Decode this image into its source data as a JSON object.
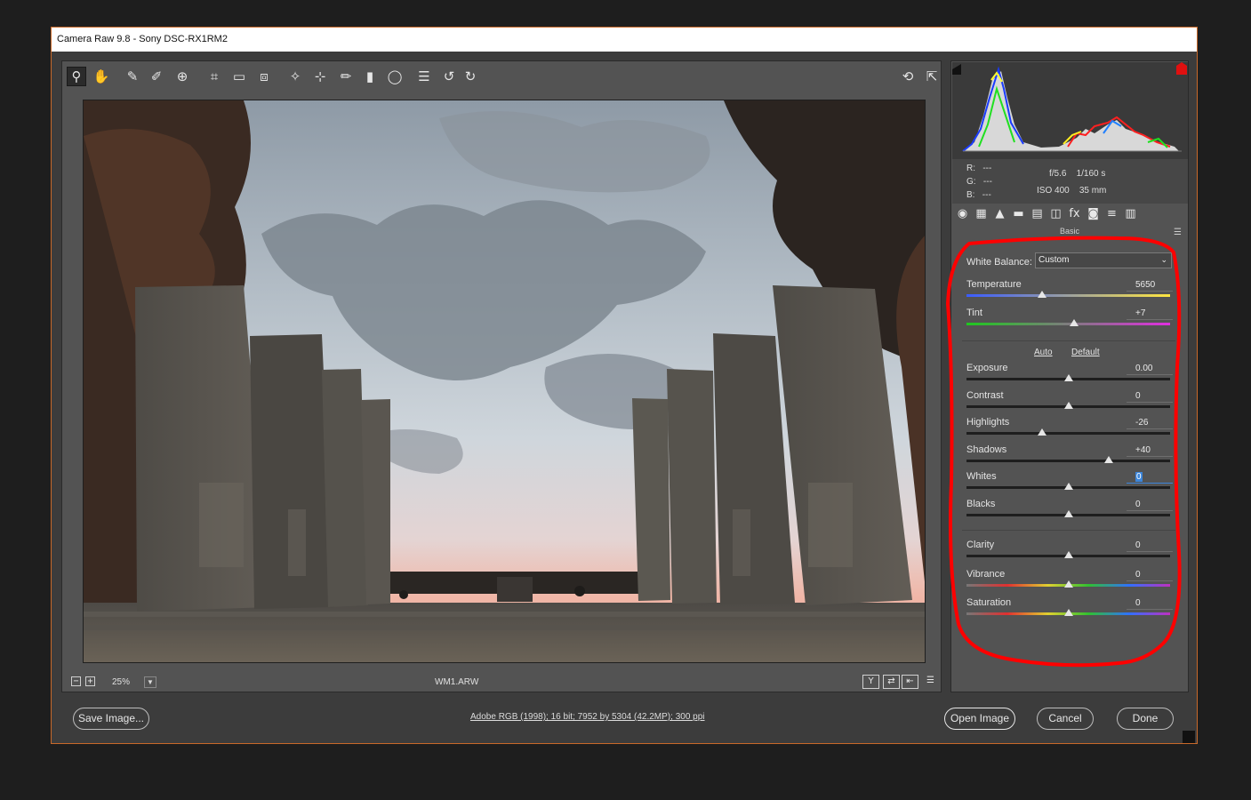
{
  "window": {
    "title": "Camera Raw 9.8  -  Sony DSC-RX1RM2"
  },
  "toolbar": {
    "tools": [
      {
        "name": "zoom-tool",
        "glyph": "⚲",
        "active": true
      },
      {
        "name": "hand-tool",
        "glyph": "✋"
      },
      {
        "name": "white-balance-tool",
        "glyph": "✎"
      },
      {
        "name": "color-sampler-tool",
        "glyph": "✐"
      },
      {
        "name": "targeted-adjustment-tool",
        "glyph": "⊕"
      },
      {
        "name": "crop-tool",
        "glyph": "⌗"
      },
      {
        "name": "straighten-tool",
        "glyph": "▭"
      },
      {
        "name": "transform-tool",
        "glyph": "⧈"
      },
      {
        "name": "spot-removal-tool",
        "glyph": "✧"
      },
      {
        "name": "red-eye-tool",
        "glyph": "⊹"
      },
      {
        "name": "adjustment-brush-tool",
        "glyph": "✏"
      },
      {
        "name": "graduated-filter-tool",
        "glyph": "▮"
      },
      {
        "name": "radial-filter-tool",
        "glyph": "◯"
      },
      {
        "name": "preferences-tool",
        "glyph": "☰"
      },
      {
        "name": "rotate-left-tool",
        "glyph": "↺"
      },
      {
        "name": "rotate-right-tool",
        "glyph": "↻"
      }
    ],
    "right_tools": [
      {
        "name": "toggle-mark-icon",
        "glyph": "⟲"
      },
      {
        "name": "fullscreen-icon",
        "glyph": "⇱"
      }
    ]
  },
  "preview": {
    "filename": "WM1.ARW",
    "zoom": "25%"
  },
  "bottom_bar": {
    "view_buttons": [
      "Y",
      "⇄",
      "⇤",
      "☰"
    ]
  },
  "histogram_info": {
    "r_label": "R:",
    "g_label": "G:",
    "b_label": "B:",
    "r_value": "---",
    "g_value": "---",
    "b_value": "---",
    "aperture": "f/5.6",
    "shutter": "1/160 s",
    "iso": "ISO 400",
    "focal": "35 mm"
  },
  "panel_tabs": [
    "◉",
    "▦",
    "▲",
    "▬",
    "▤",
    "◫",
    "fx",
    "◙",
    "≡",
    "▥"
  ],
  "panel": {
    "title": "Basic",
    "white_balance_label": "White Balance:",
    "white_balance_value": "Custom",
    "auto_label": "Auto",
    "default_label": "Default"
  },
  "sliders": [
    {
      "key": "temperature",
      "label": "Temperature",
      "value": "5650",
      "pos": 0.37
    },
    {
      "key": "tint",
      "label": "Tint",
      "value": "+7",
      "pos": 0.53
    },
    {
      "key": "exposure",
      "label": "Exposure",
      "value": "0.00",
      "pos": 0.5
    },
    {
      "key": "contrast",
      "label": "Contrast",
      "value": "0",
      "pos": 0.5
    },
    {
      "key": "highlights",
      "label": "Highlights",
      "value": "-26",
      "pos": 0.37
    },
    {
      "key": "shadows",
      "label": "Shadows",
      "value": "+40",
      "pos": 0.7
    },
    {
      "key": "whites",
      "label": "Whites",
      "value": "0",
      "pos": 0.5
    },
    {
      "key": "blacks",
      "label": "Blacks",
      "value": "0",
      "pos": 0.5
    },
    {
      "key": "clarity",
      "label": "Clarity",
      "value": "0",
      "pos": 0.5
    },
    {
      "key": "vibrance",
      "label": "Vibrance",
      "value": "0",
      "pos": 0.5
    },
    {
      "key": "saturation",
      "label": "Saturation",
      "value": "0",
      "pos": 0.5
    }
  ],
  "footer": {
    "save_label": "Save Image...",
    "file_info": "Adobe RGB (1998); 16 bit; 7952 by 5304 (42.2MP); 300 ppi",
    "open_label": "Open Image",
    "cancel_label": "Cancel",
    "done_label": "Done"
  },
  "colors": {
    "annotation": "#ff0000",
    "window_border": "#c8692a",
    "focus_blue": "#3c85d9"
  }
}
